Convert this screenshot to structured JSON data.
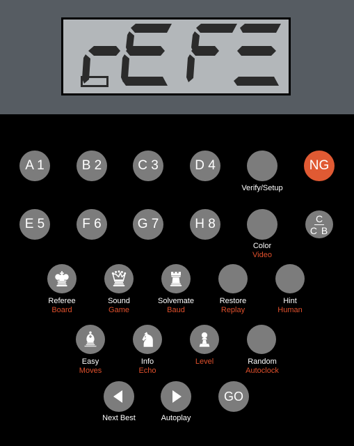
{
  "device": {
    "name": "chess-computer-keypad",
    "bezel_color": "#565c62",
    "panel_color": "#000000",
    "accent_color": "#e0502c",
    "button_color": "#7c7c7c",
    "lcd_color": "#b3b7ba"
  },
  "display": {
    "name": "lcd-display",
    "text": "rE FE",
    "characters": [
      "r",
      "E",
      " ",
      "F",
      "E"
    ],
    "segments": [
      {
        "char": "r",
        "on": [
          "e",
          "g"
        ]
      },
      {
        "char": "E",
        "on": [
          "a",
          "d",
          "e",
          "f",
          "g"
        ]
      },
      {
        "char": "F",
        "on": [
          "a",
          "e",
          "f",
          "g"
        ]
      },
      {
        "char": "E",
        "on": [
          "a",
          "d",
          "g"
        ]
      }
    ],
    "cursor_indicator": "hollow-rectangle"
  },
  "rows": {
    "row1": [
      {
        "id": "a1",
        "label": "A 1",
        "caption": "",
        "alt": "",
        "style": "gray"
      },
      {
        "id": "b2",
        "label": "B 2",
        "caption": "",
        "alt": "",
        "style": "gray"
      },
      {
        "id": "c3",
        "label": "C 3",
        "caption": "",
        "alt": "",
        "style": "gray"
      },
      {
        "id": "d4",
        "label": "D 4",
        "caption": "",
        "alt": "",
        "style": "gray"
      },
      {
        "id": "verify-setup",
        "label": "",
        "caption": "Verify/Setup",
        "alt": "",
        "style": "gray"
      },
      {
        "id": "ng",
        "label": "NG",
        "caption": "",
        "alt": "",
        "style": "orange"
      }
    ],
    "row2": [
      {
        "id": "e5",
        "label": "E 5",
        "caption": "",
        "alt": "",
        "style": "gray"
      },
      {
        "id": "f6",
        "label": "F 6",
        "caption": "",
        "alt": "",
        "style": "gray"
      },
      {
        "id": "g7",
        "label": "G 7",
        "caption": "",
        "alt": "",
        "style": "gray"
      },
      {
        "id": "h8",
        "label": "H 8",
        "caption": "",
        "alt": "",
        "style": "gray"
      },
      {
        "id": "color-video",
        "label": "",
        "caption": "Color",
        "alt": "Video",
        "style": "gray"
      },
      {
        "id": "c-cb",
        "label_top": "C",
        "label_bottom": "C B",
        "caption": "",
        "alt": "",
        "style": "gray"
      }
    ],
    "row3": [
      {
        "id": "referee-board",
        "icon": "chess-king-icon",
        "caption": "Referee",
        "alt": "Board"
      },
      {
        "id": "sound-game",
        "icon": "chess-queen-icon",
        "caption": "Sound",
        "alt": "Game"
      },
      {
        "id": "solvemate-baud",
        "icon": "chess-rook-icon",
        "caption": "Solvemate",
        "alt": "Baud"
      },
      {
        "id": "restore-replay",
        "icon": "",
        "caption": "Restore",
        "alt": "Replay"
      },
      {
        "id": "hint-human",
        "icon": "",
        "caption": "Hint",
        "alt": "Human"
      }
    ],
    "row4": [
      {
        "id": "easy-moves",
        "icon": "chess-bishop-icon",
        "caption": "Easy",
        "alt": "Moves"
      },
      {
        "id": "info-echo",
        "icon": "chess-knight-icon",
        "caption": "Info",
        "alt": "Echo"
      },
      {
        "id": "level",
        "icon": "chess-pawn-icon",
        "caption": "",
        "alt": "Level"
      },
      {
        "id": "random-autoclock",
        "icon": "",
        "caption": "Random",
        "alt": "Autoclock"
      }
    ],
    "row5": [
      {
        "id": "next-best",
        "icon": "triangle-left-icon",
        "caption": "Next Best",
        "alt": ""
      },
      {
        "id": "autoplay",
        "icon": "triangle-right-icon",
        "caption": "Autoplay",
        "alt": ""
      },
      {
        "id": "go",
        "label": "GO",
        "caption": "",
        "alt": ""
      }
    ]
  }
}
